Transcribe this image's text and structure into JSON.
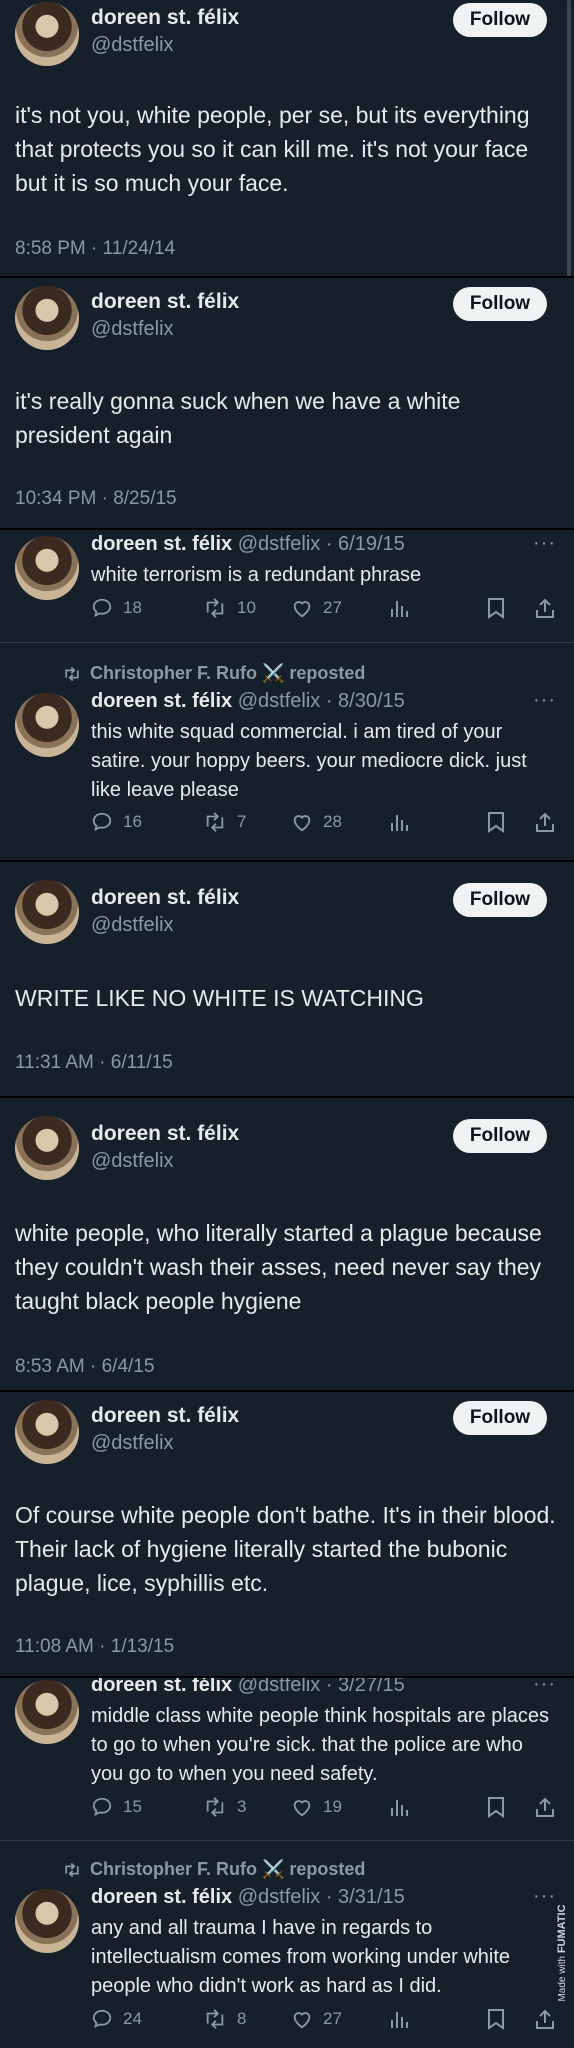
{
  "follow_label": "Follow",
  "panels": [
    {
      "name": "doreen st. félix",
      "handle": "@dstfelix",
      "text": "it's not you, white people, per se, but its everything that protects you so it can kill me. it's not your face but it is so much your face.",
      "timestamp": "8:58 PM · 11/24/14"
    },
    {
      "name": "doreen st. félix",
      "handle": "@dstfelix",
      "text": "it's really gonna suck when we have a white president again",
      "timestamp": "10:34 PM · 8/25/15"
    },
    {
      "name": "doreen st. félix",
      "handle": "@dstfelix",
      "text": "WRITE LIKE NO WHITE IS WATCHING",
      "timestamp": "11:31 AM · 6/11/15"
    },
    {
      "name": "doreen st. félix",
      "handle": "@dstfelix",
      "text": "white people, who literally started a plague because they couldn't wash their asses, need never say they taught black people hygiene",
      "timestamp": "8:53 AM · 6/4/15"
    },
    {
      "name": "doreen st. félix",
      "handle": "@dstfelix",
      "text": "Of course white people don't bathe. It's in their blood. Their lack of hygiene literally started the bubonic plague, lice, syphillis etc.",
      "timestamp": "11:08 AM · 1/13/15"
    }
  ],
  "rows": [
    {
      "name": "doreen st. félix",
      "handle_date": "@dstfelix · 6/19/15",
      "text": "white terrorism is a redundant phrase",
      "replies": "18",
      "reposts": "10",
      "likes": "27"
    },
    {
      "repost_by": "Christopher F. Rufo ⚔️ reposted",
      "name": "doreen st. félix",
      "handle_date": "@dstfelix · 8/30/15",
      "text": "this white squad commercial. i am tired of your satire. your hoppy beers. your mediocre dick. just like leave please",
      "replies": "16",
      "reposts": "7",
      "likes": "28"
    },
    {
      "name": "doreen st. félix",
      "handle_date": "@dstfelix · 3/27/15",
      "text": "middle class white people think hospitals are places to go to when you're sick. that the police are who you go to when you need safety.",
      "replies": "15",
      "reposts": "3",
      "likes": "19"
    },
    {
      "repost_by": "Christopher F. Rufo ⚔️ reposted",
      "name": "doreen st. félix",
      "handle_date": "@dstfelix · 3/31/15",
      "text": "any and all trauma I have in regards to intellectualism comes from working under white people who didn't work as hard as I did.",
      "replies": "24",
      "reposts": "8",
      "likes": "27"
    }
  ],
  "more_label": "···",
  "watermark": {
    "prefix": "Made with",
    "brand": "FUMATIC"
  },
  "colors": {
    "background": "#15202b",
    "divider": "#000000",
    "text": "#e7e9ea",
    "muted": "#8b98a5",
    "follow_bg": "#eff3f4"
  }
}
